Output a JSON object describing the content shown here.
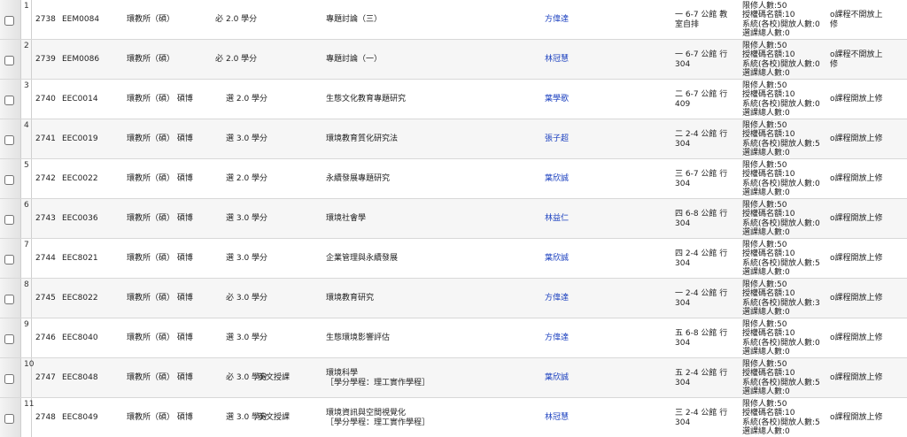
{
  "rows": [
    {
      "index": "1",
      "seq": "2738",
      "code": "EEM0084",
      "dept": "環教所（碩）",
      "req": "必",
      "credit": "2.0 學分",
      "eng": "",
      "name": "專題討論（三）",
      "name2": "",
      "teacher": "方偉達",
      "time1": "一 6-7 公館 教",
      "time2": "室自排",
      "q1": "限修人數:50",
      "q2": "授權碼名額:10",
      "q3": "系統(各校)開放人數:0",
      "q4": "選課總人數:0",
      "note1": "o課程不開放上",
      "note2": "修"
    },
    {
      "index": "2",
      "seq": "2739",
      "code": "EEM0086",
      "dept": "環教所（碩）",
      "req": "必",
      "credit": "2.0 學分",
      "eng": "",
      "name": "專題討論（一）",
      "name2": "",
      "teacher": "林冠慧",
      "time1": "一 6-7 公館 行",
      "time2": "304",
      "q1": "限修人數:50",
      "q2": "授權碼名額:10",
      "q3": "系統(各校)開放人數:0",
      "q4": "選課總人數:0",
      "note1": "o課程不開放上",
      "note2": "修"
    },
    {
      "index": "3",
      "seq": "2740",
      "code": "EEC0014",
      "dept": "環教所（碩） 碩博",
      "req": "",
      "credit": "選 2.0 學分",
      "eng": "",
      "name": "生態文化教育專題研究",
      "name2": "",
      "teacher": "葉學歌",
      "time1": "二 6-7 公館 行",
      "time2": "409",
      "q1": "限修人數:50",
      "q2": "授權碼名額:10",
      "q3": "系統(各校)開放人數:0",
      "q4": "選課總人數:0",
      "note1": "o課程開放上修",
      "note2": ""
    },
    {
      "index": "4",
      "seq": "2741",
      "code": "EEC0019",
      "dept": "環教所（碩） 碩博",
      "req": "",
      "credit": "選 3.0 學分",
      "eng": "",
      "name": "環境教育質化研究法",
      "name2": "",
      "teacher": "張子超",
      "time1": "二 2-4 公館 行",
      "time2": "304",
      "q1": "限修人數:50",
      "q2": "授權碼名額:10",
      "q3": "系統(各校)開放人數:5",
      "q4": "選課總人數:0",
      "note1": "o課程開放上修",
      "note2": ""
    },
    {
      "index": "5",
      "seq": "2742",
      "code": "EEC0022",
      "dept": "環教所（碩） 碩博",
      "req": "",
      "credit": "選 2.0 學分",
      "eng": "",
      "name": "永續發展專題研究",
      "name2": "",
      "teacher": "葉欣誠",
      "time1": "三 6-7 公館 行",
      "time2": "304",
      "q1": "限修人數:50",
      "q2": "授權碼名額:10",
      "q3": "系統(各校)開放人數:0",
      "q4": "選課總人數:0",
      "note1": "o課程開放上修",
      "note2": ""
    },
    {
      "index": "6",
      "seq": "2743",
      "code": "EEC0036",
      "dept": "環教所（碩） 碩博",
      "req": "",
      "credit": "選 3.0 學分",
      "eng": "",
      "name": "環境社會學",
      "name2": "",
      "teacher": "林益仁",
      "time1": "四 6-8 公館 行",
      "time2": "304",
      "q1": "限修人數:50",
      "q2": "授權碼名額:10",
      "q3": "系統(各校)開放人數:0",
      "q4": "選課總人數:0",
      "note1": "o課程開放上修",
      "note2": ""
    },
    {
      "index": "7",
      "seq": "2744",
      "code": "EEC8021",
      "dept": "環教所（碩） 碩博",
      "req": "",
      "credit": "選 3.0 學分",
      "eng": "",
      "name": "企業管理與永續發展",
      "name2": "",
      "teacher": "葉欣誠",
      "time1": "四 2-4 公館 行",
      "time2": "304",
      "q1": "限修人數:50",
      "q2": "授權碼名額:10",
      "q3": "系統(各校)開放人數:5",
      "q4": "選課總人數:0",
      "note1": "o課程開放上修",
      "note2": ""
    },
    {
      "index": "8",
      "seq": "2745",
      "code": "EEC8022",
      "dept": "環教所（碩） 碩博",
      "req": "",
      "credit": "必 3.0 學分",
      "eng": "",
      "name": "環境教育研究",
      "name2": "",
      "teacher": "方偉達",
      "time1": "一 2-4 公館 行",
      "time2": "304",
      "q1": "限修人數:50",
      "q2": "授權碼名額:10",
      "q3": "系統(各校)開放人數:3",
      "q4": "選課總人數:0",
      "note1": "o課程開放上修",
      "note2": ""
    },
    {
      "index": "9",
      "seq": "2746",
      "code": "EEC8040",
      "dept": "環教所（碩） 碩博",
      "req": "",
      "credit": "選 3.0 學分",
      "eng": "",
      "name": "生態環境影響評估",
      "name2": "",
      "teacher": "方偉達",
      "time1": "五 6-8 公館 行",
      "time2": "304",
      "q1": "限修人數:50",
      "q2": "授權碼名額:10",
      "q3": "系統(各校)開放人數:0",
      "q4": "選課總人數:0",
      "note1": "o課程開放上修",
      "note2": ""
    },
    {
      "index": "10",
      "seq": "2747",
      "code": "EEC8048",
      "dept": "環教所（碩） 碩博",
      "req": "",
      "credit": "必 3.0 學分",
      "eng": "英文授課",
      "name": "環境科學",
      "name2": "［學分學程：理工實作學程］",
      "teacher": "葉欣誠",
      "time1": "五 2-4 公館 行",
      "time2": "304",
      "q1": "限修人數:50",
      "q2": "授權碼名額:10",
      "q3": "系統(各校)開放人數:5",
      "q4": "選課總人數:0",
      "note1": "o課程開放上修",
      "note2": ""
    },
    {
      "index": "11",
      "seq": "2748",
      "code": "EEC8049",
      "dept": "環教所（碩） 碩博",
      "req": "",
      "credit": "選 3.0 學分",
      "eng": "英文授課",
      "name": "環境資訊與空間視覺化",
      "name2": "［學分學程：理工實作學程］",
      "teacher": "林冠慧",
      "time1": "三 2-4 公館 行",
      "time2": "304",
      "q1": "限修人數:50",
      "q2": "授權碼名額:10",
      "q3": "系統(各校)開放人數:5",
      "q4": "選課總人數:0",
      "note1": "o課程開放上修",
      "note2": ""
    }
  ]
}
